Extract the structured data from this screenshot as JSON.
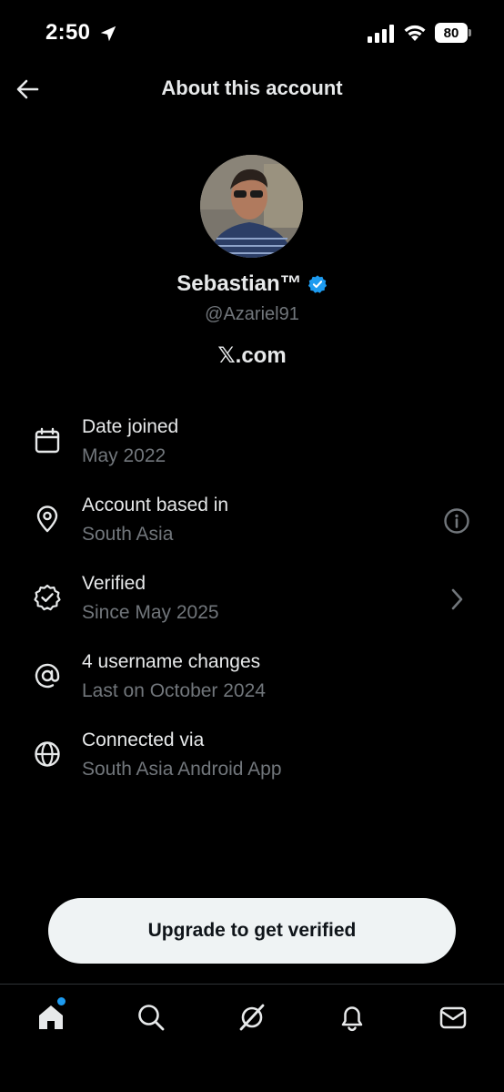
{
  "status_bar": {
    "time": "2:50",
    "battery": "80"
  },
  "header": {
    "title": "About this account"
  },
  "profile": {
    "name": "Sebastian™",
    "handle": "@Azariel91",
    "site": "𝕏.com"
  },
  "info": {
    "date_joined": {
      "title": "Date joined",
      "value": "May 2022",
      "icon": "calendar-icon"
    },
    "based_in": {
      "title": "Account based in",
      "value": "South Asia",
      "icon": "location-pin-icon",
      "trail_icon": "info-icon"
    },
    "verified": {
      "title": "Verified",
      "value": "Since May 2025",
      "icon": "verified-badge-outline-icon",
      "trail_icon": "chevron-right-icon"
    },
    "username_changes": {
      "title": "4 username changes",
      "value": "Last on October 2024",
      "icon": "at-sign-icon"
    },
    "connected_via": {
      "title": "Connected via",
      "value": "South Asia Android App",
      "icon": "globe-icon"
    }
  },
  "upgrade_button": {
    "label": "Upgrade to get verified"
  },
  "bottom_nav": {
    "items": [
      "home-icon",
      "search-icon",
      "grok-icon",
      "notifications-bell-icon",
      "messages-icon"
    ]
  },
  "colors": {
    "background": "#000000",
    "primary_text": "#e7e9ea",
    "secondary_text": "#71767b",
    "accent": "#1d9bf0",
    "button_bg": "#eff3f4"
  }
}
